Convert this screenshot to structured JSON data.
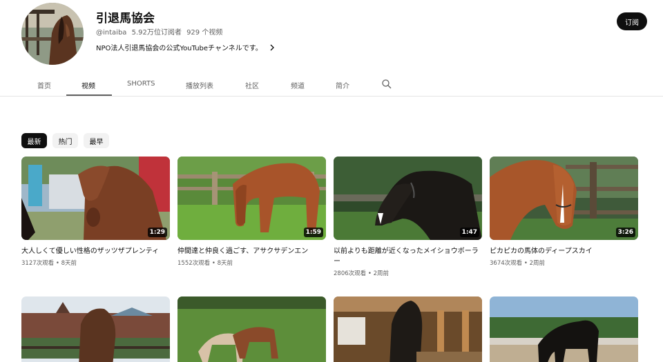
{
  "channel": {
    "name": "引退馬協会",
    "handle": "@intaiba",
    "subscribers": "5.92万位订阅者",
    "video_count": "929 个视频",
    "description": "NPO法人引退馬協会の公式YouTubeチャンネルです。",
    "subscribe_label": "订阅"
  },
  "tabs": [
    {
      "label": "首页",
      "active": false
    },
    {
      "label": "视频",
      "active": true
    },
    {
      "label": "SHORTS",
      "active": false
    },
    {
      "label": "播放列表",
      "active": false
    },
    {
      "label": "社区",
      "active": false
    },
    {
      "label": "频道",
      "active": false
    },
    {
      "label": "简介",
      "active": false
    }
  ],
  "search_icon": "search-icon",
  "filters": [
    {
      "label": "最新",
      "active": true
    },
    {
      "label": "热门",
      "active": false
    },
    {
      "label": "最早",
      "active": false
    }
  ],
  "videos": [
    {
      "title": "大人しくて優しい性格のザッツザプレンティ",
      "views": "3127次观看",
      "age": "8天前",
      "duration": "1:29"
    },
    {
      "title": "仲間達と仲良く過ごす、アサクサデンエン",
      "views": "1552次观看",
      "age": "8天前",
      "duration": "1:59"
    },
    {
      "title": "以前よりも距離が近くなったメイショウボーラー",
      "views": "2806次观看",
      "age": "2周前",
      "duration": "1:47"
    },
    {
      "title": "ピカピカの馬体のディープスカイ",
      "views": "3674次观看",
      "age": "2周前",
      "duration": "3:26"
    }
  ],
  "colors": {
    "text_primary": "#0f0f0f",
    "text_secondary": "#606060",
    "chip_bg": "#f2f2f2",
    "accent_dark": "#0f0f0f"
  }
}
